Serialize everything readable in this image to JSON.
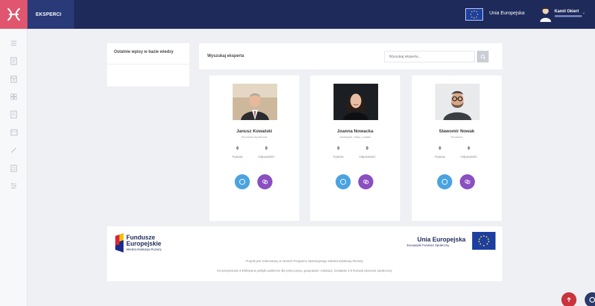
{
  "header": {
    "section_label": "EKSPERCI",
    "eu_label": "Unia Europejska",
    "user_name": "Kamil Okiert",
    "caret": "⌄"
  },
  "sidebar": {
    "icons": [
      "list-icon",
      "document-icon",
      "calendar-icon",
      "grid-icon",
      "notes-icon",
      "folder-icon",
      "link-icon",
      "calendar-alt-icon",
      "settings-icon"
    ]
  },
  "left_panel": {
    "title": "Ostatnie wpisy w bazie wiedzy"
  },
  "search": {
    "title": "Wyszukaj eksperta",
    "placeholder": "Wyszukaj eksperta..."
  },
  "experts": [
    {
      "name": "Janusz Kowalski",
      "role": "Ekonomia Społeczna",
      "questions": "0",
      "answers": "0",
      "questions_label": "Pytania",
      "answers_label": "Odpowiedzi"
    },
    {
      "name": "Joanna Nowacka",
      "role": "Inwestycje, kadry, podatki",
      "questions": "0",
      "answers": "0",
      "questions_label": "Pytania",
      "answers_label": "Odpowiedzi"
    },
    {
      "name": "Sławomir Nowak",
      "role": "Fundusze",
      "questions": "0",
      "answers": "0",
      "questions_label": "Pytania",
      "answers_label": "Odpowiedzi"
    }
  ],
  "footer": {
    "fe_line1": "Fundusze",
    "fe_line2": "Europejskie",
    "fe_line3": "Wiedza Edukacja Rozwój",
    "ue_line1": "Unia Europejska",
    "ue_line2": "Europejski Fundusz Społeczny",
    "text1": "Projekt jest realizowany w ramach Programu Operacyjnego Wiedza Edukacja Rozwój.",
    "text2": "Oś priorytetowa II Efektywne polityki publiczne dla rynku pracy, gospodarki i edukacji. Działanie 2.9 Rozwój ekonomii społecznej."
  },
  "colors": {
    "topbar": "#1e2a5a",
    "logo": "#e0566e",
    "accent_blue": "#4aa3e0",
    "accent_purple": "#8a4fc0",
    "fab_red": "#c8333c"
  }
}
